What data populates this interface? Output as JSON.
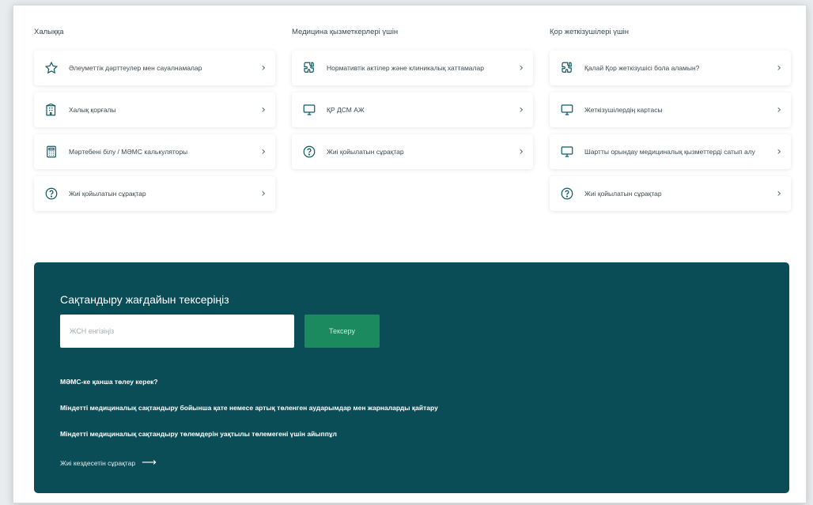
{
  "columns": [
    {
      "title": "Халыққа",
      "items": [
        {
          "label": "Әлеуметтік дәрттеулер мен сауалнамалар",
          "icon": "star-icon"
        },
        {
          "label": "Халық қорғалы",
          "icon": "building-icon"
        },
        {
          "label": "Мәртебені білу / МӘМС калькуляторы",
          "icon": "calculator-icon"
        },
        {
          "label": "Жиі қойылатын сұрақтар",
          "icon": "question-circle-icon"
        }
      ]
    },
    {
      "title": "Медицина қызметкерлері үшін",
      "items": [
        {
          "label": "Нормативтік актілер және клиникалық хаттамалар",
          "icon": "puzzle-icon"
        },
        {
          "label": "ҚР ДСМ АЖ",
          "icon": "monitor-icon"
        },
        {
          "label": "Жиі қойылатын сұрақтар",
          "icon": "question-circle-icon"
        }
      ]
    },
    {
      "title": "Қор жеткізушілері үшін",
      "items": [
        {
          "label": "Қалай Қор жеткізушісі бола аламын?",
          "icon": "puzzle-icon"
        },
        {
          "label": "Жеткізушілердің картасы",
          "icon": "monitor-icon"
        },
        {
          "label": "Шартты орындау медициналық қызметтерді сатып алу",
          "icon": "monitor-icon"
        },
        {
          "label": "Жиі қойылатын сұрақтар",
          "icon": "question-circle-icon"
        }
      ]
    }
  ],
  "panel": {
    "title": "Сақтандыру жағдайын тексеріңіз",
    "input_placeholder": "ЖСН енгізіңіз",
    "button_label": "Тексеру",
    "links": [
      "МӘМС-ке қанша төлеу керек?",
      "Міндетті медициналық сақтандыру бойынша қате немесе артық төленген аударымдар мен жарналарды қайтару",
      "Міндетті медициналық сақтандыру төлемдерін уақтылы төлемегені үшін айыппұл"
    ],
    "faq_label": "Жиі кездесетін сұрақтар",
    "faq_arrow": "⟶"
  },
  "chevron": "›",
  "colors": {
    "panel_bg": "#0b4d57",
    "button_bg": "#1c8a5f",
    "icon_stroke": "#0b5a63"
  }
}
